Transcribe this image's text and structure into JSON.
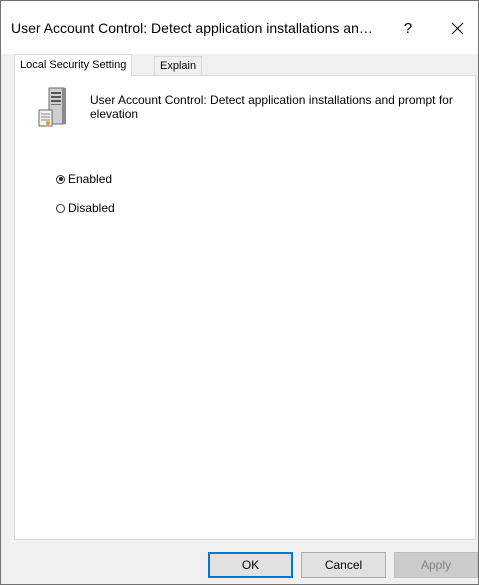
{
  "window": {
    "title": "User Account Control: Detect application installations an…",
    "help_label": "?",
    "close_label": "×"
  },
  "tabs": [
    {
      "label": "Local Security Setting",
      "active": true
    },
    {
      "label": "Explain",
      "active": false
    }
  ],
  "policy": {
    "title": "User Account Control: Detect application installations and prompt for elevation",
    "icon": "server-policy-icon"
  },
  "options": [
    {
      "label": "Enabled",
      "checked": true
    },
    {
      "label": "Disabled",
      "checked": false
    }
  ],
  "buttons": {
    "ok": "OK",
    "cancel": "Cancel",
    "apply": "Apply"
  },
  "colors": {
    "focus_border": "#0078d7",
    "dialog_bg": "#f0f0f0",
    "disabled_text": "#838383"
  }
}
